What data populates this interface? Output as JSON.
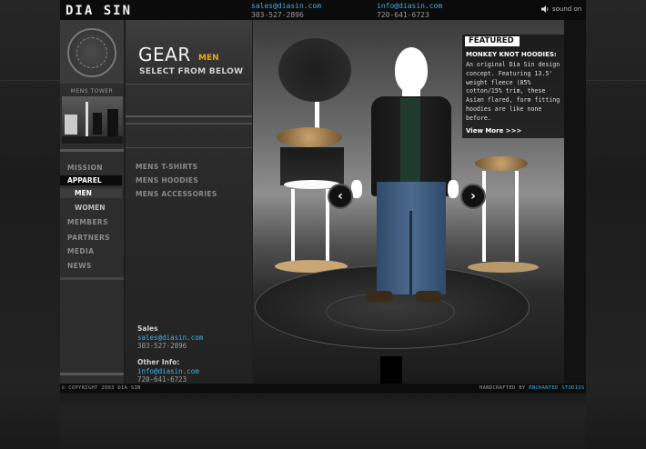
{
  "header": {
    "logo": "DIA SIN",
    "contact_sales": {
      "email": "sales@diasin.com",
      "phone": "303-527-2896"
    },
    "contact_info": {
      "email": "info@diasin.com",
      "phone": "720-641-6723"
    },
    "sound_label": "sound on"
  },
  "sidebar": {
    "tower_label": "MENS TOWER",
    "nav": [
      {
        "label": "MISSION"
      },
      {
        "label": "APPAREL"
      },
      {
        "label": "MEN"
      },
      {
        "label": "WOMEN"
      },
      {
        "label": "MEMBERS"
      },
      {
        "label": "PARTNERS"
      },
      {
        "label": "MEDIA"
      },
      {
        "label": "NEWS"
      }
    ]
  },
  "gear": {
    "title": "GEAR",
    "subtitle": "MEN",
    "instruction": "SELECT FROM BELOW",
    "categories": [
      "MENS T-SHIRTS",
      "MENS HOODIES",
      "MENS ACCESSORIES"
    ]
  },
  "contacts": {
    "sales_label": "Sales",
    "sales_email": "sales@diasin.com",
    "sales_phone": "303-527-2896",
    "other_label": "Other Info:",
    "other_email": "info@diasin.com",
    "other_phone": "720-641-6723"
  },
  "featured": {
    "badge": "FEATURED",
    "headline": "MONKEY KNOT HOODIES:",
    "body": "An original Dia Sin design concept. Featuring 13.5' weight fleece (85% cotton/15% trim, these Asian flared, form fitting hoodies are like none before.",
    "more_link": "View More >>>"
  },
  "carousel": {
    "prev_icon": "chevron-left-icon",
    "next_icon": "chevron-right-icon",
    "prev_glyph": "‹",
    "next_glyph": "›"
  },
  "footer": {
    "copyright": "© COPYRIGHT 2003 DIA SIN",
    "handcrafted": "HANDCRAFTED BY",
    "studio": "ENCHANTED STUDIOS"
  },
  "colors": {
    "accent_blue": "#3cb0e6",
    "accent_orange": "#e9a520",
    "background": "#1e1e1e"
  }
}
